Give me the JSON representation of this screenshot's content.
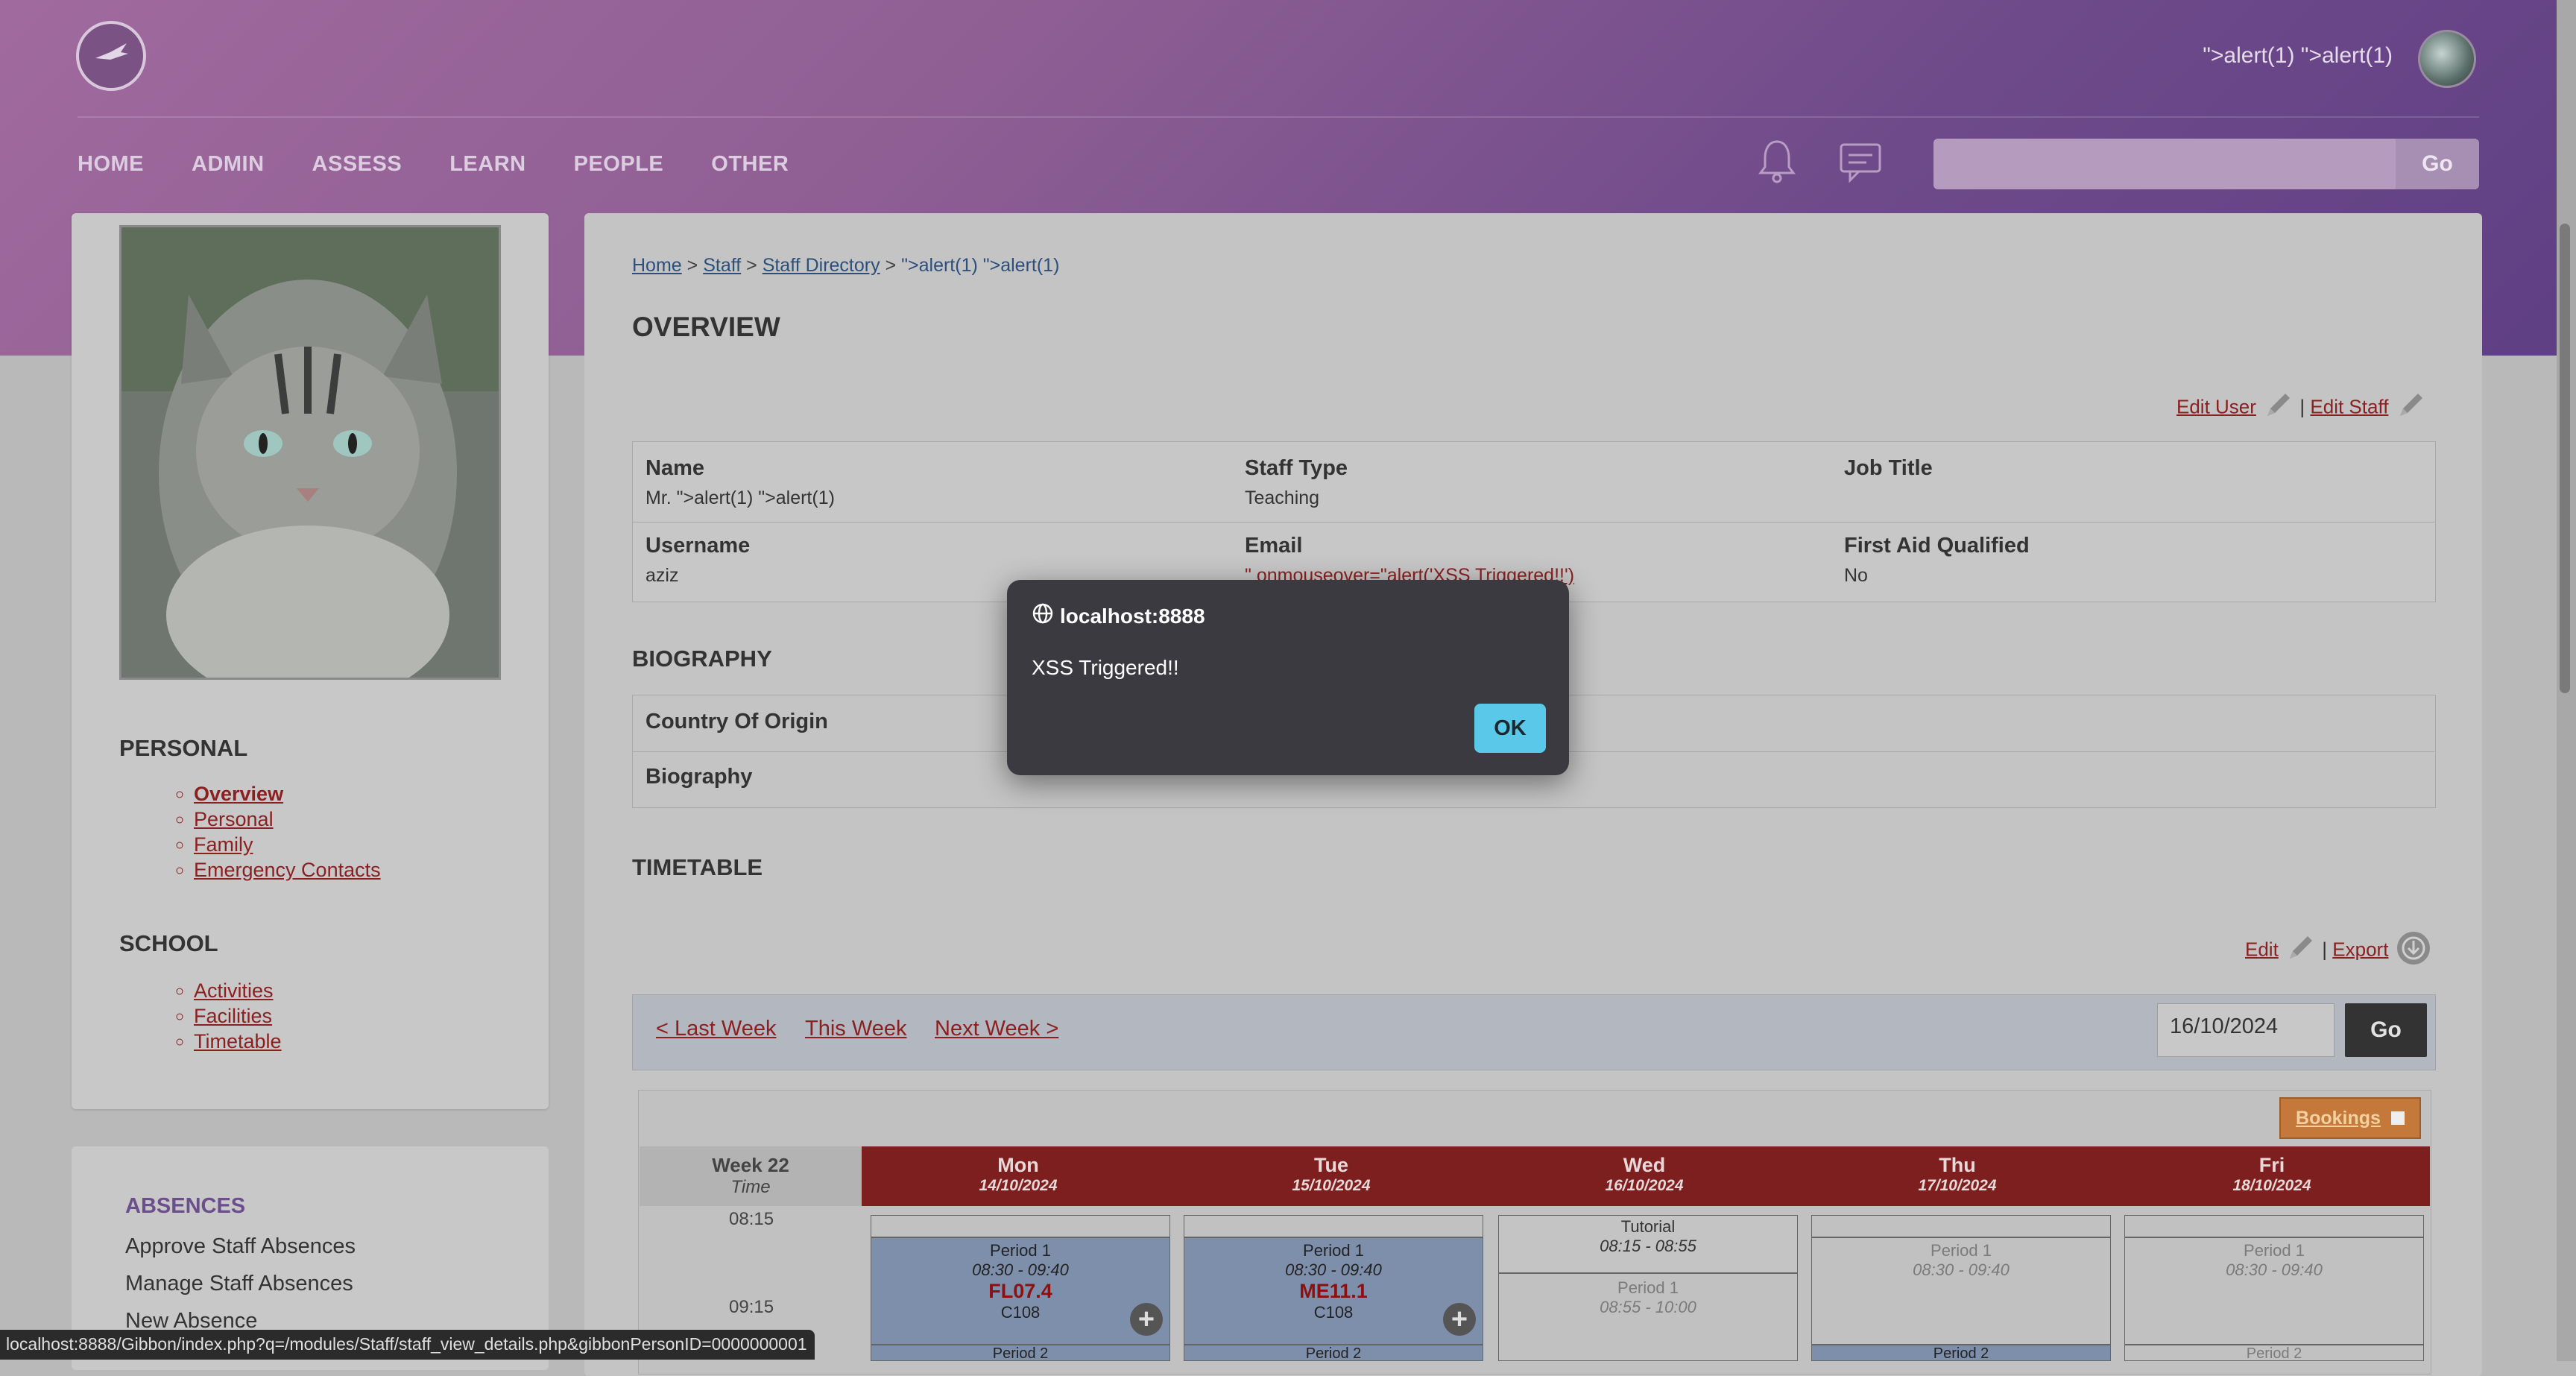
{
  "header": {
    "user_name": "\">alert(1) \">alert(1)",
    "logo_text": "Gibbon",
    "nav": [
      "HOME",
      "ADMIN",
      "ASSESS",
      "LEARN",
      "PEOPLE",
      "OTHER"
    ],
    "search_placeholder": "",
    "search_button": "Go"
  },
  "sidebar": {
    "personal_title": "PERSONAL",
    "personal_links": [
      "Overview",
      "Personal",
      "Family",
      "Emergency Contacts"
    ],
    "school_title": "SCHOOL",
    "school_links": [
      "Activities",
      "Facilities",
      "Timetable"
    ],
    "absences_title": "ABSENCES",
    "absences_links": [
      "Approve Staff Absences",
      "Manage Staff Absences",
      "New Absence"
    ]
  },
  "breadcrumb": {
    "items": [
      "Home",
      "Staff",
      "Staff Directory"
    ],
    "separator": ">",
    "current": "\">alert(1) \">alert(1)"
  },
  "overview": {
    "title": "OVERVIEW",
    "edit_user": "Edit User",
    "edit_staff": "Edit Staff",
    "divider": "|",
    "fields": {
      "name_label": "Name",
      "name_value": "Mr. \">alert(1) \">alert(1)",
      "staff_type_label": "Staff Type",
      "staff_type_value": "Teaching",
      "job_title_label": "Job Title",
      "job_title_value": "",
      "username_label": "Username",
      "username_value": "aziz",
      "email_label": "Email",
      "email_value": "\" onmouseover=\"alert('XSS Triggered!!')",
      "first_aid_label": "First Aid Qualified",
      "first_aid_value": "No"
    }
  },
  "biography": {
    "title": "BIOGRAPHY",
    "country_label": "Country Of Origin",
    "biography_label": "Biography"
  },
  "timetable": {
    "title": "TIMETABLE",
    "edit": "Edit",
    "export": "Export",
    "last_week": "< Last Week",
    "this_week": "This Week",
    "next_week": "Next Week >",
    "date_value": "16/10/2024",
    "go": "Go",
    "bookings": "Bookings",
    "week_label": "Week 22",
    "time_label": "Time",
    "times": [
      "08:15",
      "09:15"
    ],
    "days": [
      {
        "name": "Mon",
        "date": "14/10/2024"
      },
      {
        "name": "Tue",
        "date": "15/10/2024"
      },
      {
        "name": "Wed",
        "date": "16/10/2024"
      },
      {
        "name": "Thu",
        "date": "17/10/2024"
      },
      {
        "name": "Fri",
        "date": "18/10/2024"
      }
    ],
    "slots": {
      "mon": {
        "period": "Period 1",
        "time": "08:30 - 09:40",
        "code": "FL07.4",
        "room": "C108",
        "next": "Period 2"
      },
      "tue": {
        "period": "Period 1",
        "time": "08:30 - 09:40",
        "code": "ME11.1",
        "room": "C108",
        "next": "Period 2"
      },
      "wed": {
        "tutorial": "Tutorial",
        "tutorial_time": "08:15 - 08:55",
        "period": "Period 1",
        "time": "08:55 - 10:00"
      },
      "thu": {
        "period": "Period 1",
        "time": "08:30 - 09:40",
        "next": "Period 2"
      },
      "fri": {
        "period": "Period 1",
        "time": "08:30 - 09:40",
        "next": "Period 2"
      }
    }
  },
  "dialog": {
    "origin": "localhost:8888",
    "message": "XSS Triggered!!",
    "ok": "OK"
  },
  "status_url": "localhost:8888/Gibbon/index.php?q=/modules/Staff/staff_view_details.php&gibbonPersonID=0000000001",
  "colors": {
    "accent_red": "#8b2020",
    "day_header": "#7d1f1f",
    "dialog_bg": "#3b3a40",
    "ok_button": "#5ac8e8",
    "header_purple": "#6e4a8a"
  }
}
